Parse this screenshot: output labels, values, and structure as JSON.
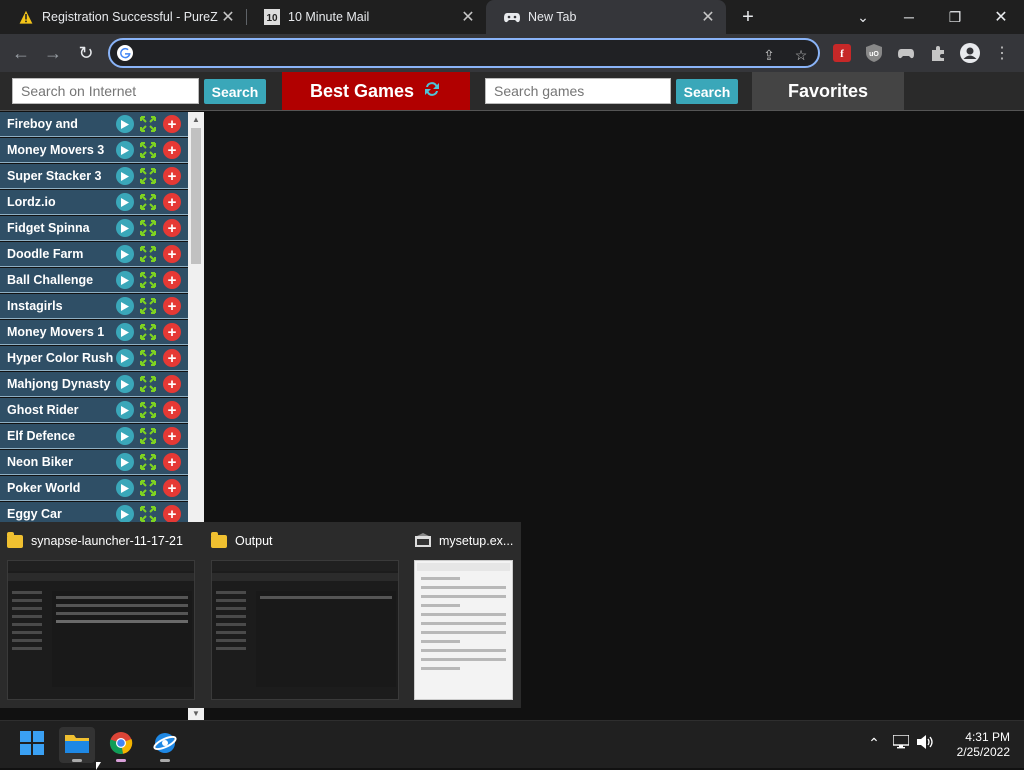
{
  "tabs": [
    {
      "title": "Registration Successful - PureZC",
      "favicon": "warning-icon"
    },
    {
      "title": "10 Minute Mail",
      "favicon": "ten-icon"
    },
    {
      "title": "New Tab",
      "favicon": "gamepad-icon"
    }
  ],
  "toolbar": {
    "url": ""
  },
  "gamebar": {
    "search_internet_placeholder": "Search on Internet",
    "search_button": "Search",
    "best_games": "Best Games",
    "search_games_placeholder": "Search games",
    "search_button2": "Search",
    "favorites": "Favorites"
  },
  "games": [
    "Fireboy and",
    "Money Movers 3",
    "Super Stacker 3",
    "Lordz.io",
    "Fidget Spinna",
    "Doodle Farm",
    "Ball Challenge",
    "Instagirls",
    "Money Movers 1",
    "Hyper Color Rush",
    "Mahjong Dynasty",
    "Ghost Rider",
    "Elf Defence",
    "Neon Biker",
    "Poker World",
    "Eggy Car"
  ],
  "popup": {
    "items": [
      {
        "title": "synapse-launcher-11-17-21",
        "icon": "folder-icon"
      },
      {
        "title": "Output",
        "icon": "folder-icon"
      },
      {
        "title": "mysetup.ex...",
        "icon": "setup-icon"
      }
    ]
  },
  "clock": {
    "time": "4:31 PM",
    "date": "2/25/2022"
  },
  "colors": {
    "accent": "#8ab4f8",
    "best_games_bg": "#b10000",
    "search_btn": "#3aa7b9",
    "game_row": "#2f4f66"
  }
}
